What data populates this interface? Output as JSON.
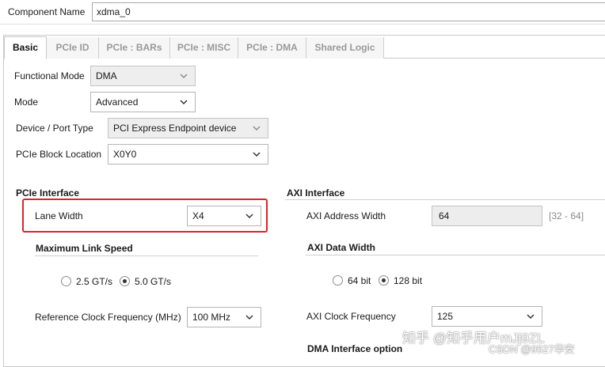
{
  "header": {
    "component_name_label": "Component Name",
    "component_name_value": "xdma_0"
  },
  "tabs": [
    {
      "label": "Basic",
      "active": true
    },
    {
      "label": "PCIe ID"
    },
    {
      "label": "PCIe : BARs"
    },
    {
      "label": "PCIe : MISC"
    },
    {
      "label": "PCIe : DMA"
    },
    {
      "label": "Shared Logic"
    }
  ],
  "basic": {
    "functional_mode": {
      "label": "Functional Mode",
      "value": "DMA"
    },
    "mode": {
      "label": "Mode",
      "value": "Advanced"
    },
    "device_port_type": {
      "label": "Device / Port Type",
      "value": "PCI Express Endpoint device"
    },
    "pcie_block_location": {
      "label": "PCIe Block Location",
      "value": "X0Y0"
    }
  },
  "pcie_interface": {
    "title": "PCIe Interface",
    "lane_width": {
      "label": "Lane Width",
      "value": "X4"
    },
    "max_link_speed": {
      "title": "Maximum Link Speed",
      "options": [
        {
          "label": "2.5 GT/s",
          "selected": false
        },
        {
          "label": "5.0 GT/s",
          "selected": true
        }
      ]
    },
    "ref_clock": {
      "label": "Reference Clock Frequency (MHz)",
      "value": "100 MHz"
    }
  },
  "axi_interface": {
    "title": "AXI Interface",
    "address_width": {
      "label": "AXI Address Width",
      "value": "64",
      "range": "[32 - 64]"
    },
    "data_width": {
      "title": "AXI Data Width",
      "options": [
        {
          "label": "64 bit",
          "selected": false
        },
        {
          "label": "128 bit",
          "selected": true
        }
      ]
    },
    "clock_freq": {
      "label": "AXI Clock Frequency",
      "value": "125"
    },
    "dma_interface_option": "DMA Interface option"
  },
  "watermark": {
    "line1": "知乎 @知乎用户mJj9ZL",
    "line2": "CSDN @9527华安"
  },
  "colors": {
    "highlight": "#d7262d",
    "tab_inactive_text": "#9a9a9a",
    "readonly_bg": "#ededed"
  },
  "icons": {
    "dropdown": "chevron-down-icon",
    "radio": "radio-button"
  }
}
